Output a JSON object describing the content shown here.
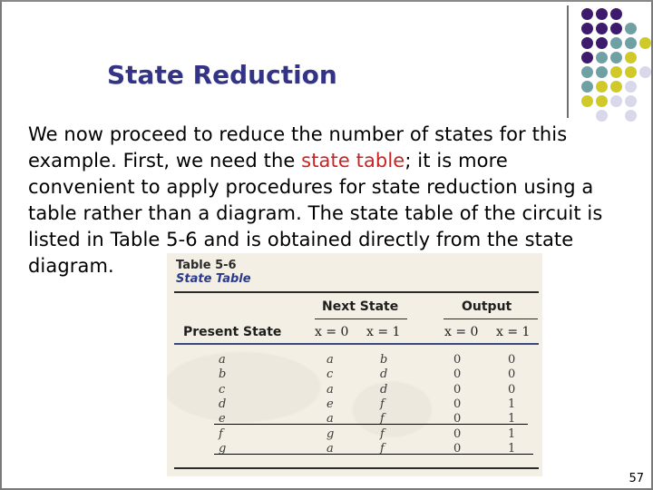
{
  "slide": {
    "title": "State Reduction",
    "body": {
      "lines": [
        [
          "We now proceed to reduce the number of states for this"
        ],
        [
          "example. First, we need the ",
          "state table",
          "; it is more"
        ],
        [
          "convenient to apply procedures for state reduction using a"
        ],
        [
          "table rather than a diagram. The state table of the circuit is"
        ],
        [
          "listed in Table 5-6 and is obtained directly from the state"
        ],
        [
          "diagram."
        ]
      ],
      "highlight_text": "state table",
      "highlight_color": "#cc2222"
    },
    "page_number": "57",
    "title_color": "#333388"
  },
  "decoration": {
    "dot_colors": {
      "purple": "#3d1a6b",
      "teal": "#6fa0a3",
      "yellow": "#cfc92a",
      "lavender": "#d8d8ea"
    },
    "dot_grid": [
      [
        "purple",
        "purple",
        "purple",
        null,
        null
      ],
      [
        "purple",
        "purple",
        "purple",
        "teal",
        null
      ],
      [
        "purple",
        "purple",
        "teal",
        "teal",
        "yellow"
      ],
      [
        "purple",
        "teal",
        "teal",
        "yellow",
        null
      ],
      [
        "teal",
        "teal",
        "yellow",
        "yellow",
        "lavender"
      ],
      [
        "teal",
        "yellow",
        "yellow",
        "lavender",
        null
      ],
      [
        "yellow",
        "yellow",
        "lavender",
        "lavender",
        null
      ],
      [
        null,
        "lavender",
        null,
        "lavender",
        null
      ]
    ]
  },
  "table": {
    "caption_number": "Table 5-6",
    "caption_title": "State Table",
    "group_headers": {
      "next_state": "Next State",
      "output": "Output"
    },
    "row_header": "Present State",
    "sub_headers": {
      "x0": "x = 0",
      "x1": "x = 1"
    },
    "rows": [
      {
        "present": "a",
        "next_x0": "a",
        "next_x1": "b",
        "out_x0": "0",
        "out_x1": "0"
      },
      {
        "present": "b",
        "next_x0": "c",
        "next_x1": "d",
        "out_x0": "0",
        "out_x1": "0"
      },
      {
        "present": "c",
        "next_x0": "a",
        "next_x1": "d",
        "out_x0": "0",
        "out_x1": "0"
      },
      {
        "present": "d",
        "next_x0": "e",
        "next_x1": "f",
        "out_x0": "0",
        "out_x1": "1"
      },
      {
        "present": "e",
        "next_x0": "a",
        "next_x1": "f",
        "out_x0": "0",
        "out_x1": "1"
      },
      {
        "present": "f",
        "next_x0": "g",
        "next_x1": "f",
        "out_x0": "0",
        "out_x1": "1"
      },
      {
        "present": "g",
        "next_x0": "a",
        "next_x1": "f",
        "out_x0": "0",
        "out_x1": "1"
      }
    ],
    "underlined_rows": [
      "e",
      "g"
    ]
  }
}
